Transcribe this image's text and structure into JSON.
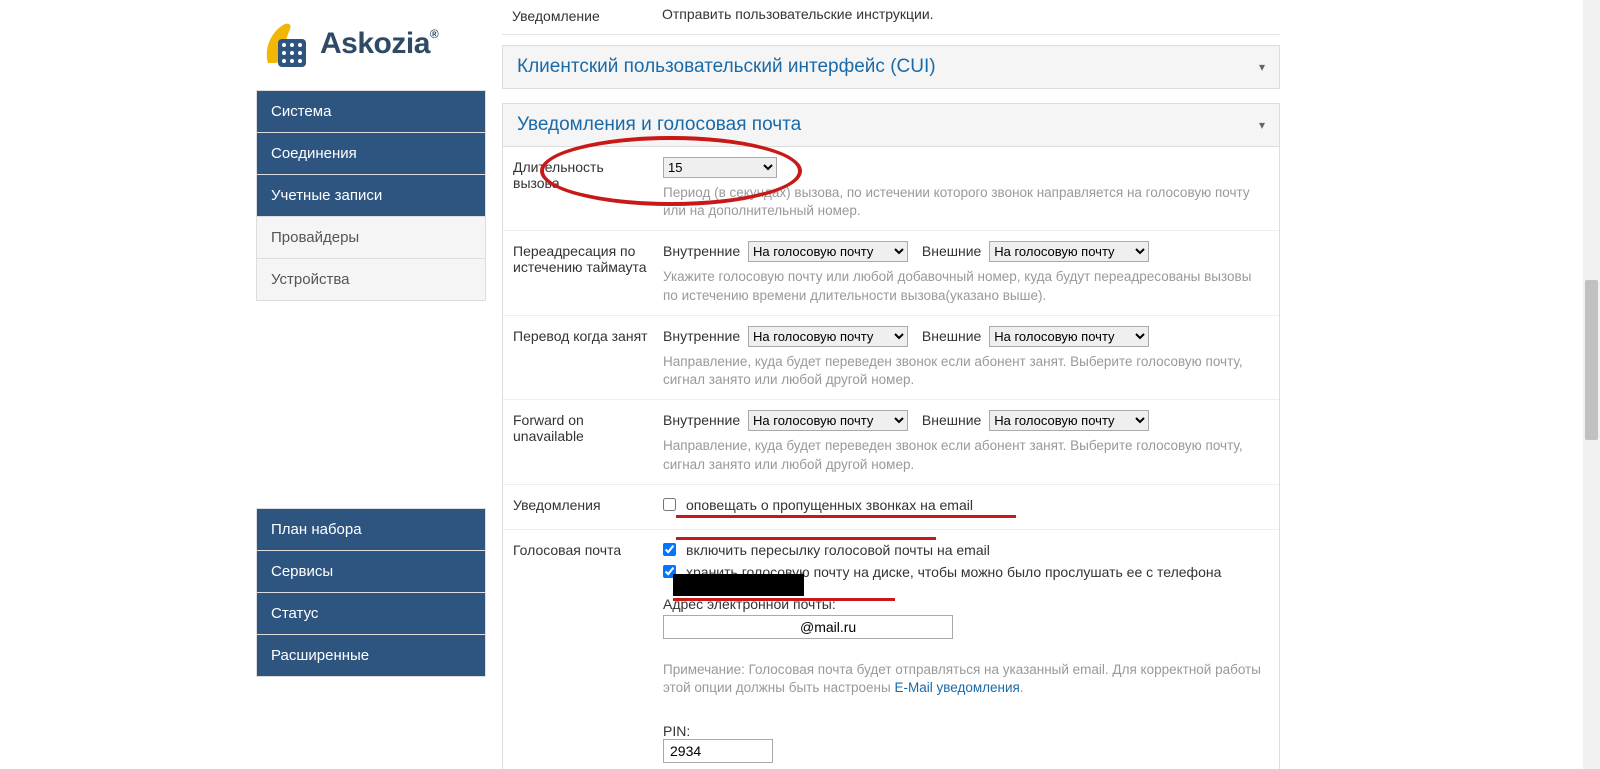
{
  "logo": {
    "text": "Askozia",
    "r": "®"
  },
  "sidebar": {
    "group1": [
      {
        "label": "Система",
        "dark": true
      },
      {
        "label": "Соединения",
        "dark": true
      },
      {
        "label": "Учетные записи",
        "dark": true
      },
      {
        "label": "Провайдеры",
        "dark": false
      },
      {
        "label": "Устройства",
        "dark": false
      }
    ],
    "group2": [
      {
        "label": "План набора"
      },
      {
        "label": "Сервисы"
      },
      {
        "label": "Статус"
      },
      {
        "label": "Расширенные"
      }
    ]
  },
  "topRow": {
    "label": "Уведомление",
    "value": "Отправить пользовательские инструкции."
  },
  "panels": {
    "cui": "Клиентский пользовательский интерфейс (CUI)",
    "voicemail": "Уведомления и голосовая почта"
  },
  "form": {
    "ringLength": {
      "label": "Длительность вызова",
      "value": "15",
      "help": "Период (в секундах) вызова, по истечении которого звонок направляется на голосовую почту или на дополнительный номер."
    },
    "forwardTimeout": {
      "label": "Переадресация по истечению таймаута",
      "internalLabel": "Внутренние",
      "externalLabel": "Внешние",
      "internalValue": "На голосовую почту",
      "externalValue": "На голосовую почту",
      "help": "Укажите голосовую почту или любой добавочный номер, куда будут переадресованы вызовы по истечению времени длительности вызова(указано выше)."
    },
    "forwardBusy": {
      "label": "Перевод когда занят",
      "internalLabel": "Внутренние",
      "externalLabel": "Внешние",
      "internalValue": "На голосовую почту",
      "externalValue": "На голосовую почту",
      "help": "Направление, куда будет переведен звонок если абонент занят. Выберите голосовую почту, сигнал занято или любой другой номер."
    },
    "forwardUnavailable": {
      "label": "Forward on unavailable",
      "internalLabel": "Внутренние",
      "externalLabel": "Внешние",
      "internalValue": "На голосовую почту",
      "externalValue": "На голосовую почту",
      "help": "Направление, куда будет переведен звонок если абонент занят. Выберите голосовую почту, сигнал занято или любой другой номер."
    },
    "notifications": {
      "label": "Уведомления",
      "checkbox": "оповещать о пропущенных звонках на email"
    },
    "voicemail": {
      "label": "Голосовая почта",
      "chk1": "включить пересылку голосовой почты на email",
      "chk2": "хранить голосовую почту на диске, чтобы можно было прослушать ее с телефона",
      "emailLabel": "Адрес электронной почты:",
      "emailSuffix": "@mail.ru",
      "noteLead": "Примечание: Голосовая почта будет отправляться на указанный email. Для корректной работы этой опции должны быть настроены ",
      "noteLink": "E-Mail уведомления",
      "noteTail": ".",
      "pinLabel": "PIN:",
      "pinValue": "2934"
    }
  }
}
